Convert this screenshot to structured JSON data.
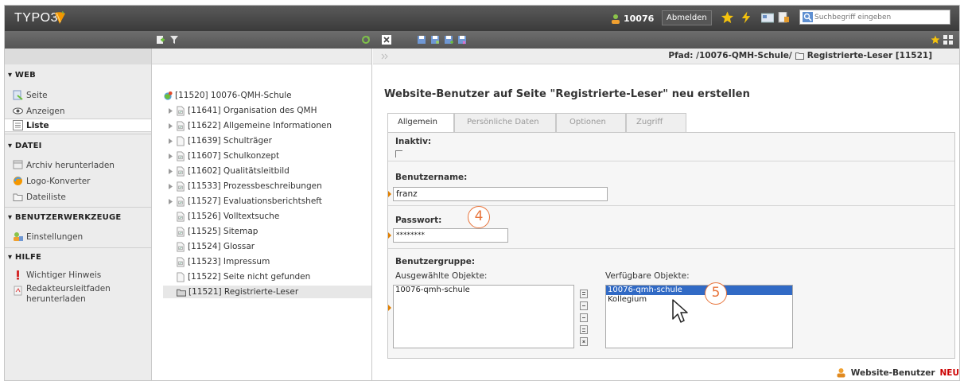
{
  "app": {
    "logo_text": "TYPO3"
  },
  "topbar": {
    "username": "10076",
    "logout_label": "Abmelden",
    "search_placeholder": "Suchbegriff eingeben"
  },
  "menu": {
    "groups": [
      {
        "label": "▾ WEB",
        "items": [
          {
            "label": "Seite"
          },
          {
            "label": "Anzeigen"
          },
          {
            "label": "Liste"
          }
        ]
      },
      {
        "label": "▾ DATEI",
        "items": [
          {
            "label": "Archiv herunterladen"
          },
          {
            "label": "Logo-Konverter"
          },
          {
            "label": "Dateiliste"
          }
        ]
      },
      {
        "label": "▾ BENUTZERWERKZEUGE",
        "items": [
          {
            "label": "Einstellungen"
          }
        ]
      },
      {
        "label": "▾ HILFE",
        "items": [
          {
            "label": "Wichtiger Hinweis"
          },
          {
            "label": "Redakteursleitfaden",
            "label2": "herunterladen"
          }
        ]
      }
    ]
  },
  "tree": {
    "root": "[11520] 10076-QMH-Schule",
    "nodes": [
      "[11641] Organisation des QMH",
      "[11622] Allgemeine Informationen",
      "[11639] Schulträger",
      "[11607] Schulkonzept",
      "[11602] Qualitätsleitbild",
      "[11533] Prozessbeschreibungen",
      "[11527] Evaluationsberichtsheft",
      "[11526] Volltextsuche",
      "[11525] Sitemap",
      "[11524] Glossar",
      "[11523] Impressum",
      "[11522] Seite nicht gefunden",
      "[11521] Registrierte-Leser"
    ]
  },
  "content": {
    "path_prefix": "Pfad: /10076-QMH-Schule/",
    "path_page": "Registrierte-Leser [11521]",
    "heading": "Website-Benutzer auf Seite \"Registrierte-Leser\" neu erstellen",
    "tabs": [
      "Allgemein",
      "Persönliche Daten",
      "Optionen",
      "Zugriff"
    ],
    "fields": {
      "inaktiv_label": "Inaktiv:",
      "username_label": "Benutzername:",
      "username_value": "franz",
      "password_label": "Passwort:",
      "password_value": "********",
      "group_label": "Benutzergruppe:",
      "selected_label": "Ausgewählte Objekte:",
      "selected_items": [
        "10076-qmh-schule"
      ],
      "available_label": "Verfügbare Objekte:",
      "available_items": [
        "10076-qmh-schule",
        "Kollegium"
      ]
    },
    "footer_label": "Website-Benutzer",
    "footer_new": "NEU"
  },
  "callouts": {
    "four": "4",
    "five": "5"
  }
}
